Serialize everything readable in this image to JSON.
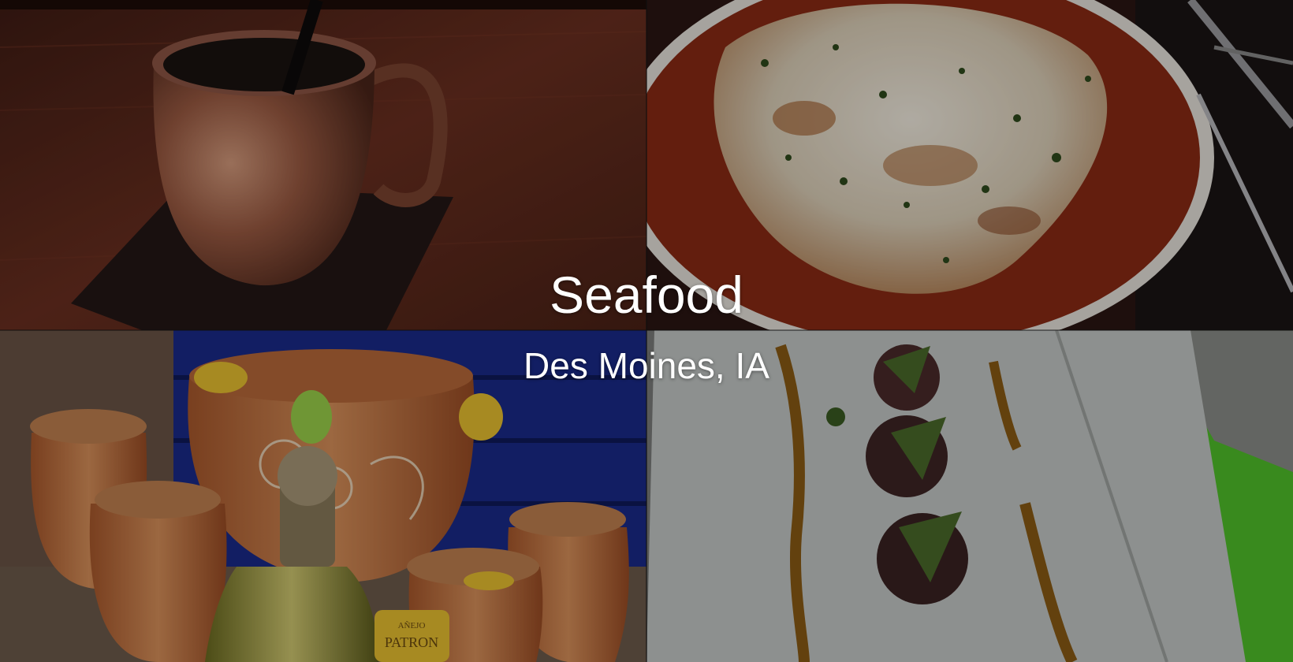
{
  "hero": {
    "title": "Seafood",
    "location": "Des Moines, IA"
  },
  "tiles": [
    {
      "subject": "copper mug drink on coaster"
    },
    {
      "subject": "baked dish with melted cheese and herbs"
    },
    {
      "subject": "clay cantarito cups with tequila bottle"
    },
    {
      "subject": "plated appetizer on white dish"
    }
  ],
  "bottle_label": {
    "line1": "AÑEJO",
    "line2": "PATRON"
  },
  "colors": {
    "overlay": "#000000",
    "text": "#ffffff",
    "wood": "#5a2a1c",
    "sauce": "#8a2a14",
    "clay": "#b8683a",
    "green_accent": "#4fc02a"
  }
}
